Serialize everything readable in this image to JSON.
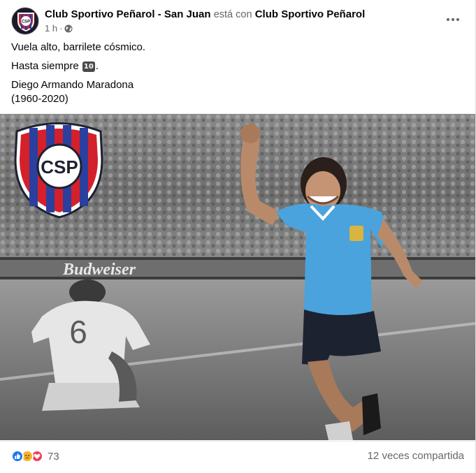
{
  "post": {
    "page_name": "Club Sportivo Peñarol - San Juan",
    "connector": "está con",
    "tagged_page": "Club Sportivo Peñarol",
    "time": "1 h",
    "time_separator": "·",
    "privacy_icon": "globe-icon",
    "more_icon": "more-options-icon",
    "avatar_icon": "club-crest-icon",
    "lines": [
      "Vuela alto, barrilete cósmico.",
      "Hasta siempre",
      "Diego Armando Maradona",
      "(1960-2020)"
    ],
    "ten_emoji": "10",
    "ten_suffix": "."
  },
  "photo": {
    "crest_text": "CSP",
    "banner_text": "Budweiser",
    "jersey_number": "6",
    "colors": {
      "crest_red": "#d4202a",
      "crest_blue": "#2b3f9e",
      "jersey_blue": "#4aa3dc",
      "shorts": "#1c2230"
    }
  },
  "footer": {
    "reaction_icons": [
      "like-icon",
      "sad-icon",
      "love-icon"
    ],
    "reaction_count": "73",
    "shares": "12 veces compartida"
  },
  "colors": {
    "text_primary": "#050505",
    "text_secondary": "#65676b",
    "like_blue": "#1877f2",
    "love_red": "#f33e58",
    "sad_yellow": "#f7b125"
  }
}
